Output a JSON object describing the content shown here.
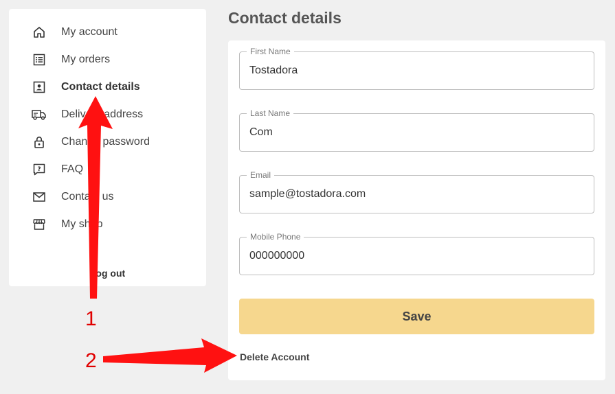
{
  "page": {
    "title": "Contact details"
  },
  "sidebar": {
    "items": [
      {
        "label": "My account",
        "icon": "home-icon"
      },
      {
        "label": "My orders",
        "icon": "list-icon"
      },
      {
        "label": "Contact details",
        "icon": "contact-icon",
        "active": true
      },
      {
        "label": "Delivery address",
        "icon": "truck-icon"
      },
      {
        "label": "Change password",
        "icon": "lock-icon"
      },
      {
        "label": "FAQ",
        "icon": "question-icon"
      },
      {
        "label": "Contact us",
        "icon": "mail-icon"
      },
      {
        "label": "My shop",
        "icon": "shop-icon"
      }
    ],
    "logout": "Log out"
  },
  "form": {
    "first_name": {
      "label": "First Name",
      "value": "Tostadora"
    },
    "last_name": {
      "label": "Last Name",
      "value": "Com"
    },
    "email": {
      "label": "Email",
      "value": "sample@tostadora.com"
    },
    "mobile": {
      "label": "Mobile Phone",
      "value": "000000000"
    },
    "save_label": "Save",
    "delete_label": "Delete Account"
  },
  "annotations": {
    "arrow1_label": "1",
    "arrow2_label": "2",
    "color": "#ff0000"
  },
  "colors": {
    "save_button": "#f6d78e",
    "background": "#f0f0f0"
  }
}
